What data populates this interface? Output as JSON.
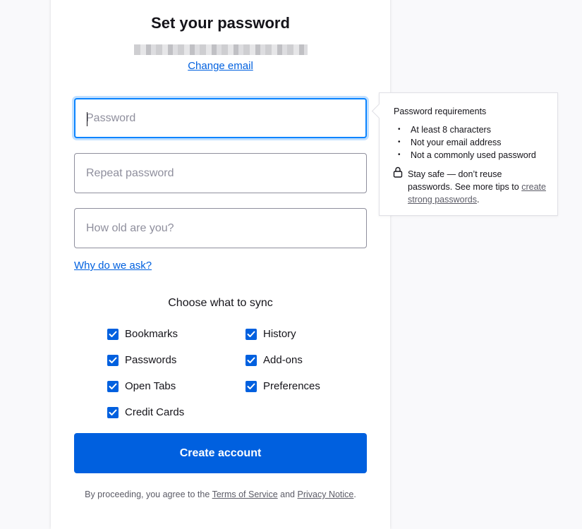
{
  "header": {
    "title": "Set your password",
    "change_email": "Change email"
  },
  "form": {
    "password_placeholder": "Password",
    "repeat_placeholder": "Repeat password",
    "age_placeholder": "How old are you?",
    "why_link": "Why do we ask?"
  },
  "sync": {
    "title": "Choose what to sync",
    "items": [
      {
        "label": "Bookmarks",
        "checked": true
      },
      {
        "label": "History",
        "checked": true
      },
      {
        "label": "Passwords",
        "checked": true
      },
      {
        "label": "Add-ons",
        "checked": true
      },
      {
        "label": "Open Tabs",
        "checked": true
      },
      {
        "label": "Preferences",
        "checked": true
      },
      {
        "label": "Credit Cards",
        "checked": true
      }
    ]
  },
  "submit": {
    "label": "Create account"
  },
  "legal": {
    "prefix": "By proceeding, you agree to the",
    "terms": "Terms of Service",
    "and": "and",
    "privacy": "Privacy Notice",
    "suffix": "."
  },
  "requirements": {
    "heading": "Password requirements",
    "items": [
      "At least 8 characters",
      "Not your email address",
      "Not a commonly used password"
    ],
    "tip_text": "Stay safe — don’t reuse passwords. See more tips to",
    "tip_link": "create strong passwords",
    "tip_suffix": ".",
    "lock_icon": "lock-icon"
  },
  "colors": {
    "accent": "#0060df",
    "focus_ring": "#0a84ff",
    "background": "#f9f9fb"
  }
}
